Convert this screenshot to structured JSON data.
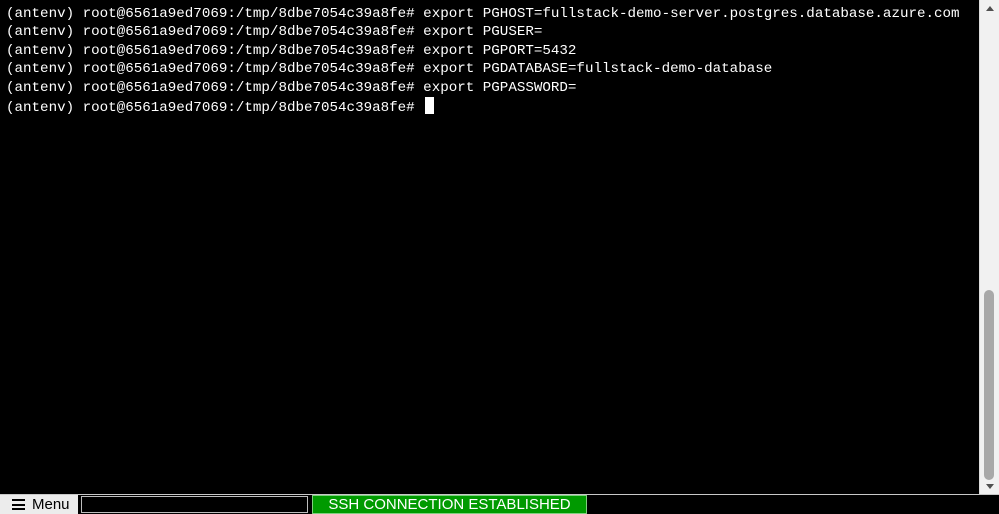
{
  "terminal": {
    "lines": [
      "(antenv) root@6561a9ed7069:/tmp/8dbe7054c39a8fe# export PGHOST=fullstack-demo-server.postgres.database.azure.com",
      "(antenv) root@6561a9ed7069:/tmp/8dbe7054c39a8fe# export PGUSER=",
      "(antenv) root@6561a9ed7069:/tmp/8dbe7054c39a8fe# export PGPORT=5432",
      "(antenv) root@6561a9ed7069:/tmp/8dbe7054c39a8fe# export PGDATABASE=fullstack-demo-database",
      "(antenv) root@6561a9ed7069:/tmp/8dbe7054c39a8fe# export PGPASSWORD=",
      "(antenv) root@6561a9ed7069:/tmp/8dbe7054c39a8fe# "
    ],
    "background_color": "#000000",
    "text_color": "#ffffff"
  },
  "statusbar": {
    "menu_label": "Menu",
    "menu_icon": "hamburger-menu-icon",
    "command_input_value": "",
    "connection_status": "SSH CONNECTION ESTABLISHED",
    "connection_status_color": "#009a00"
  },
  "scrollbar": {
    "up_icon": "scroll-up-arrow-icon",
    "down_icon": "scroll-down-arrow-icon"
  }
}
